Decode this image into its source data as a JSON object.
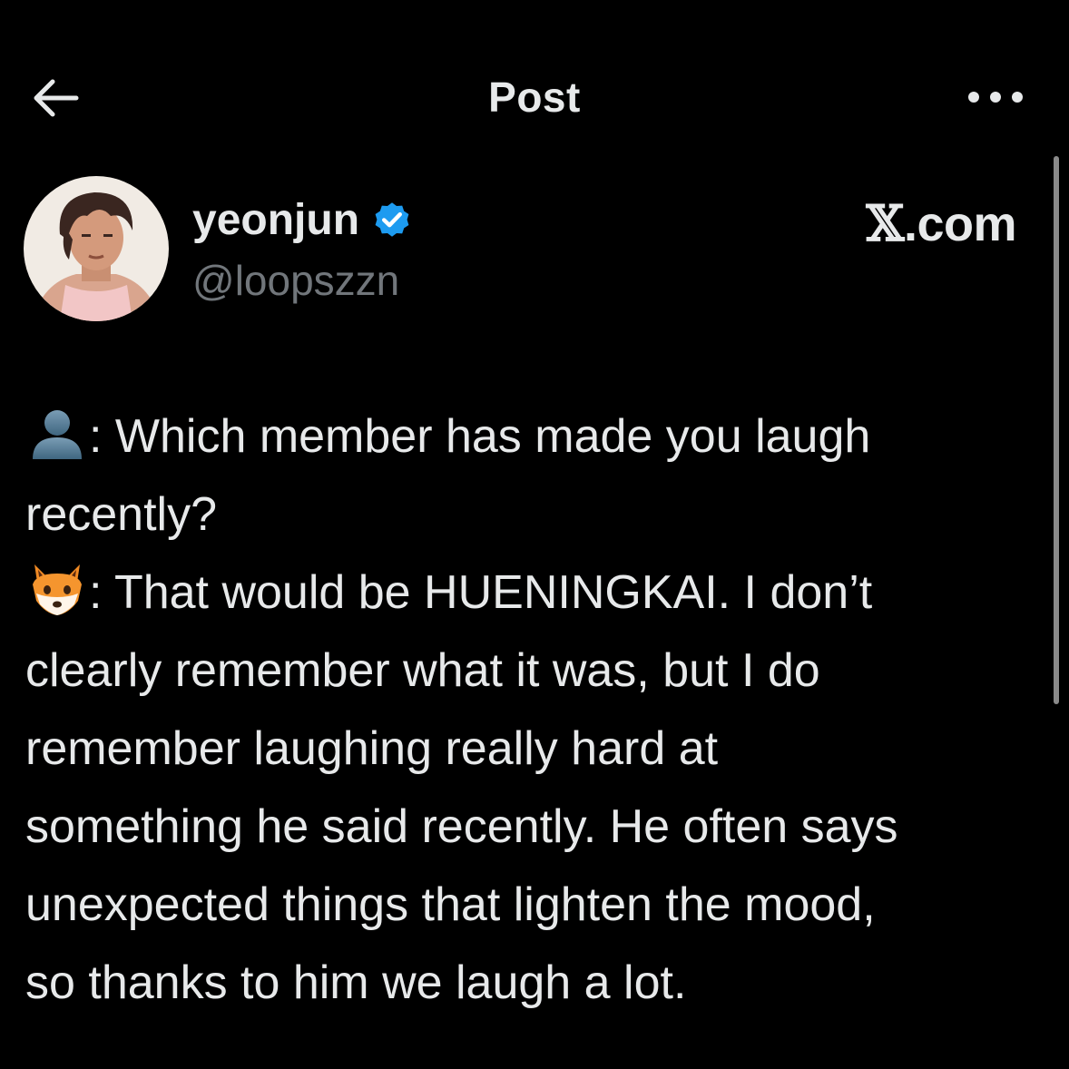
{
  "header": {
    "title": "Post",
    "back_icon": "arrow-left-icon",
    "more_icon": "more-horizontal-icon"
  },
  "author": {
    "name": "yeonjun",
    "handle": "@loopszzn",
    "verified": true,
    "verified_color": "#1d9bf0"
  },
  "watermark": {
    "glyph": "𝕏",
    "text": ".com"
  },
  "post": {
    "q_emoji": "bust-in-silhouette-emoji",
    "a_emoji": "fox-face-emoji",
    "lines": [
      ": Which member has made you laugh",
      "recently?",
      ": That would be HUENINGKAI. I don’t",
      "clearly remember what it was, but I do",
      "remember laughing really hard at",
      "something he said recently. He often says",
      "unexpected things that lighten the mood,",
      "so thanks to him we laugh a lot."
    ]
  },
  "colors": {
    "background": "#000000",
    "text": "#e7e9ea",
    "secondary_text": "#71767b",
    "accent": "#1d9bf0"
  }
}
